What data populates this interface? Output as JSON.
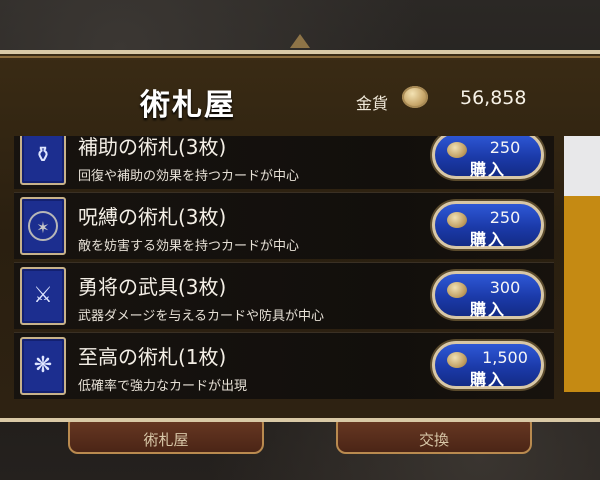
{
  "shop": {
    "title": "術札屋",
    "gold_label": "金貨",
    "gold_value": "56,858"
  },
  "items": [
    {
      "name": "補助の術札(3枚)",
      "desc": "回復や補助の効果を持つカードが中心",
      "price": "250",
      "buy_label": "購入",
      "icon": "potion-icon"
    },
    {
      "name": "呪縛の術札(3枚)",
      "desc": "敵を妨害する効果を持つカードが中心",
      "price": "250",
      "buy_label": "購入",
      "icon": "rune-circle-icon"
    },
    {
      "name": "勇将の武具(3枚)",
      "desc": "武器ダメージを与えるカードや防具が中心",
      "price": "300",
      "buy_label": "購入",
      "icon": "weapon-icon"
    },
    {
      "name": "至高の術札(1枚)",
      "desc": "低確率で強力なカードが出現",
      "price": "1,500",
      "buy_label": "購入",
      "icon": "dragon-icon"
    }
  ],
  "bottom_tabs": [
    {
      "label": "術札屋"
    },
    {
      "label": "交換"
    }
  ],
  "colors": {
    "panel": "#2a1f10",
    "button_blue": "#1b3aa9",
    "scroll_thumb": "#c58a13"
  }
}
